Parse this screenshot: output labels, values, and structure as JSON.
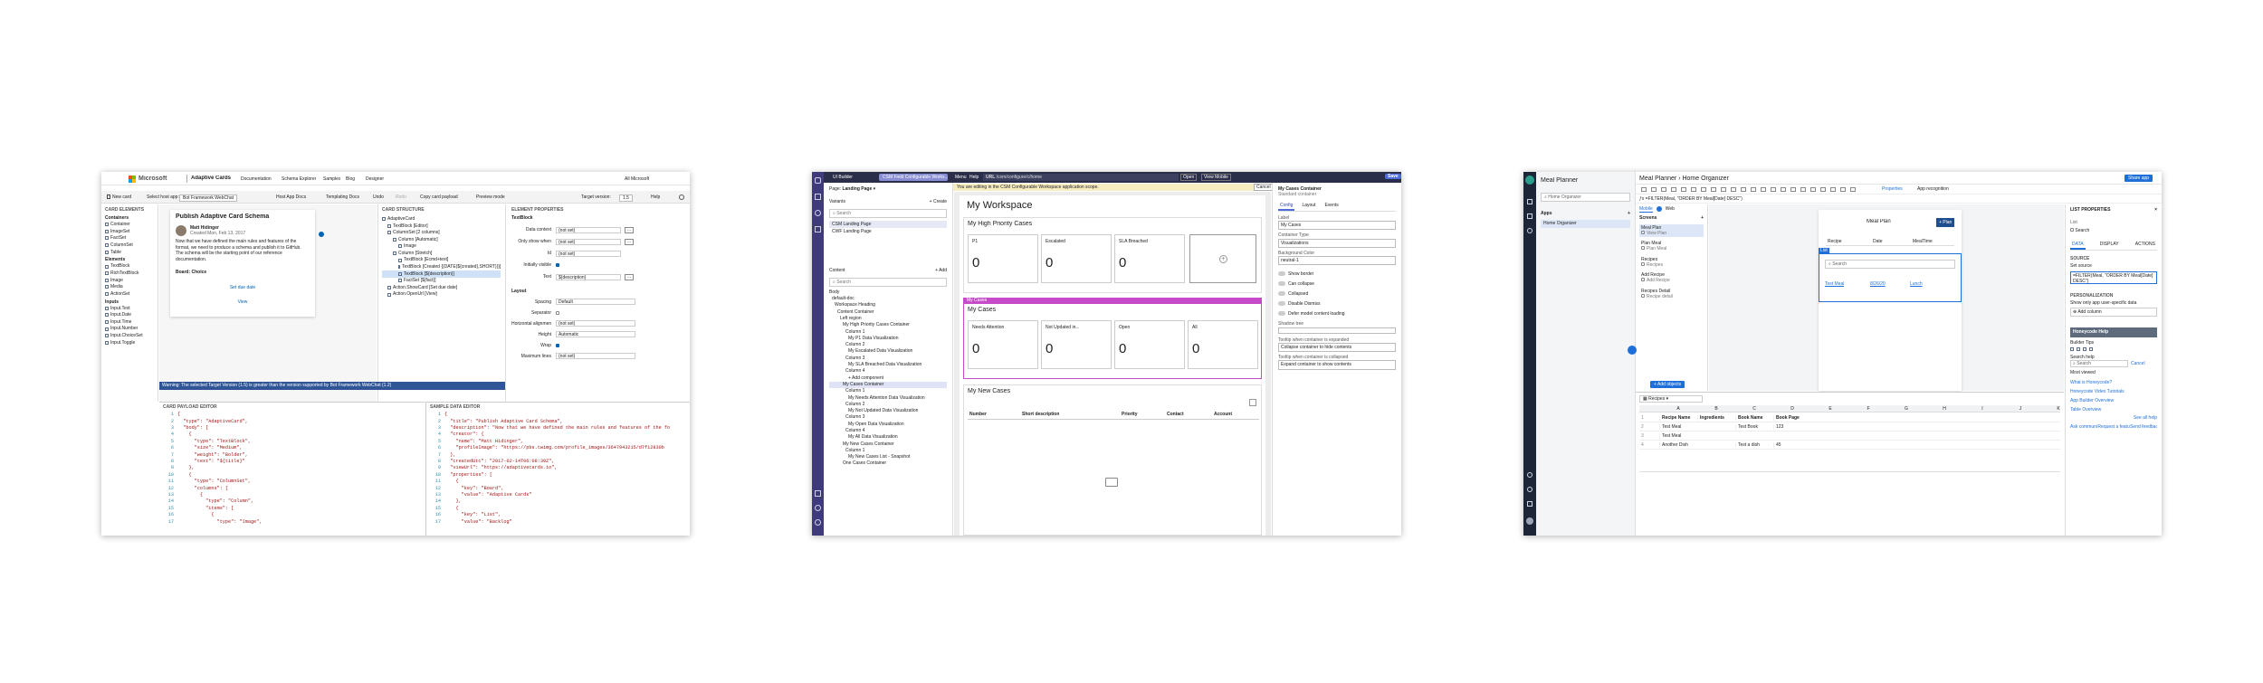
{
  "ac": {
    "brand": "Microsoft",
    "title": "Adaptive Cards",
    "nav": [
      "Documentation",
      "Schema Explorer",
      "Samples",
      "Blog",
      "Designer"
    ],
    "account": "All Microsoft",
    "toolbar": [
      "New card",
      "Select host app:",
      "Bot Framework WebChat",
      "Host App Docs",
      "Templating Docs",
      "Undo",
      "Redo",
      "Copy card payload",
      "Preview mode"
    ],
    "target_label": "Target version:",
    "target_value": "1.5",
    "help": "Help",
    "elements_title": "CARD ELEMENTS",
    "elements_groups": [
      {
        "name": "Containers",
        "items": [
          "Container",
          "ImageSet",
          "FactSet",
          "ColumnSet",
          "Table"
        ]
      },
      {
        "name": "Elements",
        "items": [
          "TextBlock",
          "RichTextBlock",
          "Image",
          "Media",
          "ActionSet"
        ]
      },
      {
        "name": "Inputs",
        "items": [
          "Input.Text",
          "Input.Date",
          "Input.Time",
          "Input.Number",
          "Input.ChoiceSet",
          "Input.Toggle"
        ]
      }
    ],
    "card": {
      "title": "Publish Adaptive Card Schema",
      "author": "Matt Hidinger",
      "created": "Created Mon, Feb 13, 2017",
      "body": "Now that we have defined the main rules and features of the format, we need to produce a schema and publish it to GitHub. The schema will be the starting point of our reference documentation.",
      "choice": "Choice",
      "due": "Set due date",
      "view": "View"
    },
    "structure_title": "CARD STRUCTURE",
    "structure": [
      "AdaptiveCard",
      "TextBlock [Editor]",
      "ColumnSet [2 columns]",
      "Column [Automatic]",
      "Image",
      "Column [Stretch]",
      "TextBlock [Ecmd+text]",
      "TextBlock [Created {{DATE(${created},SHORT)}}]",
      "TextBlock [${description}]",
      "FactSet [${fact}]",
      "Action.ShowCard [Set due date]",
      "Action.OpenUrl [View]"
    ],
    "props_title": "ELEMENT PROPERTIES",
    "props_type": "TextBlock",
    "props": [
      [
        "Data context",
        "(not set)"
      ],
      [
        "Only show when",
        "(not set)"
      ],
      [
        "Id",
        "(not set)"
      ],
      [
        "Initially visible",
        ""
      ],
      [
        "Text",
        "${description}"
      ]
    ],
    "layout_title": "Layout",
    "layout": [
      [
        "Spacing",
        "Default"
      ],
      [
        "Separator",
        ""
      ],
      [
        "Horizontal alignment",
        "(not set)"
      ],
      [
        "Height",
        "Automatic"
      ],
      [
        "Wrap",
        ""
      ],
      [
        "Maximum lines",
        "(not set)"
      ]
    ],
    "warning": "Warning: The selected Target Version (1.5) is greater than the version supported by Bot Framework WebChat (1.2)",
    "payload_title": "CARD PAYLOAD EDITOR",
    "payload_lines": [
      "{",
      "  \"type\": \"AdaptiveCard\",",
      "  \"body\": [",
      "    {",
      "      \"type\": \"TextBlock\",",
      "      \"size\": \"Medium\",",
      "      \"weight\": \"Bolder\",",
      "      \"text\": \"${title}\"",
      "    },",
      "    {",
      "      \"type\": \"ColumnSet\",",
      "      \"columns\": [",
      "        {",
      "          \"type\": \"Column\",",
      "          \"items\": [",
      "            {",
      "              \"type\": \"Image\","
    ],
    "sample_title": "SAMPLE DATA EDITOR",
    "sample_lines": [
      "{",
      "  \"title\": \"Publish Adaptive Card Schema\",",
      "  \"description\": \"Now that we have defined the main rules and features of the fo",
      "  \"creator\": {",
      "    \"name\": \"Matt Hidinger\",",
      "    \"profileImage\": \"https://pbs.twimg.com/profile_images/3647943215/d7f12830b",
      "  },",
      "  \"createdUtc\": \"2017-02-14T06:08:39Z\",",
      "  \"viewUrl\": \"https://adaptivecards.io\",",
      "  \"properties\": [",
      "    {",
      "      \"key\": \"Board\",",
      "      \"value\": \"Adaptive Cards\"",
      "    },",
      "    {",
      "      \"key\": \"List\",",
      "      \"value\": \"Backlog\""
    ]
  },
  "ui": {
    "title": "UI Builder",
    "tab": "CSM Field Configurable Works...",
    "menu": [
      "Menu",
      "Help"
    ],
    "url": "/csm/configure/c/home",
    "open": "Open",
    "view_mode": "View Mobile",
    "save": "Save",
    "banner": "You are editing in the CSM Configurable Workspace application scope.",
    "cancel": "Cancel",
    "page_label": "Page",
    "page_value": "Landing Page",
    "variants_title": "Variants",
    "create": "+ Create",
    "search": "Search",
    "variants": [
      "CSM Landing Page",
      "CWF Landing Page"
    ],
    "content_title": "Content",
    "add": "+ Add",
    "tree": [
      "Body",
      "default-doc",
      "Workspace Heading",
      "Content Container",
      "Left region",
      "My High Priority Cases Container",
      "Column 1",
      "My P1 Data Visualization",
      "Column 2",
      "My Escalated Data Visualization",
      "Column 3",
      "My SLA Breached Data Visualization",
      "Column 4",
      "+ Add component",
      "My Cases Container",
      "Column 1",
      "My Needs Attention Data Visualization",
      "Column 2",
      "My Not Updated Data Visualization",
      "Column 3",
      "My Open Data Visualization",
      "Column 4",
      "My All Data Visualization",
      "My New Cases Container",
      "Column 1",
      "My New Cases List - Snapshot",
      "One Cases Container"
    ],
    "ws_title": "My Workspace",
    "hp_title": "My High Priority Cases",
    "hp_cards": [
      {
        "label": "P1",
        "value": "0"
      },
      {
        "label": "Escalated",
        "value": "0"
      },
      {
        "label": "SLA Breached",
        "value": "0"
      }
    ],
    "toolbar_tag": "My Cases",
    "mc_title": "My Cases",
    "mc_cards": [
      {
        "label": "Needs Attention",
        "value": "0"
      },
      {
        "label": "Not Updated in...",
        "value": "0"
      },
      {
        "label": "Open",
        "value": "0"
      },
      {
        "label": "All",
        "value": "0"
      }
    ],
    "nc_title": "My New Cases",
    "nc_cols": [
      "Number",
      "Short description",
      "Priority",
      "Contact",
      "Account"
    ],
    "cfg_title": "My Cases Container",
    "cfg_sub": "Standard container",
    "cfg_tabs": [
      "Config",
      "Layout",
      "Events"
    ],
    "cfg_fields": [
      [
        "Label",
        "My Cases"
      ],
      [
        "Container Type",
        "Visualizations"
      ],
      [
        "Background Color",
        "neutral-1"
      ]
    ],
    "cfg_toggles": [
      "Show border",
      "Can collapse",
      "Collapsed",
      "Disable Dismiss",
      "Defer model content loading"
    ],
    "cfg_text": [
      [
        "Tooltip when container is expanded",
        "Collapse container to hide contents"
      ],
      [
        "Tooltip when container is collapsed",
        "Expand container to show contents"
      ]
    ],
    "shadow_label": "Shadow tree"
  },
  "pa": {
    "app": "Meal Planner",
    "crumb": "Home Organizer",
    "share": "Share app",
    "apps_title": "Apps",
    "search": "Home Organizer",
    "apps": [
      "Home Organizer"
    ],
    "tabs": [
      "Mobile",
      "Web"
    ],
    "screens_title": "Screens",
    "screens": [
      [
        "Meal Plan",
        "View Plan"
      ],
      [
        "Plan Meal",
        "Plan Meal"
      ],
      [
        "Recipes",
        "Recipes"
      ],
      [
        "Add Recipe",
        "Add Recipe"
      ],
      [
        "Recipes Detail",
        "Recipe detail"
      ]
    ],
    "add_objects": "Add objects",
    "formula": "=FILTER(Meal, \"ORDER BY Meal[Date] DESC\")",
    "props_toggle": "Properties",
    "app_recognition": "App recognition",
    "share_btn": "Share app",
    "preview_title": "Meal Plan",
    "plan_btn": "+ Plan",
    "cols": [
      "Recipe",
      "Date",
      "MealTime"
    ],
    "list_search": "Search",
    "row": [
      "Test Meal",
      "8/26/20",
      "Lunch"
    ],
    "grid_sheet": "Recipes",
    "grid_headers": [
      "A",
      "B",
      "C",
      "D",
      "E",
      "F",
      "G",
      "H",
      "I",
      "J",
      "K"
    ],
    "grid_rows": [
      [
        "Recipe Name",
        "Ingredients",
        "Book Name",
        "Book Page"
      ],
      [
        "Test Meal",
        "",
        "Test Book",
        "123"
      ],
      [
        "Test Meal",
        "",
        "",
        ""
      ],
      [
        "Another Dish",
        "",
        "Test a dish",
        "45"
      ]
    ],
    "rp_title": "LIST PROPERTIES",
    "rp_list": "List",
    "rp_item": "Search",
    "rp_tabs": [
      "DATA",
      "DISPLAY",
      "ACTIONS"
    ],
    "rp_source_title": "SOURCE",
    "rp_source_label": "Set source",
    "rp_source_value": "=FILTER(Meal, \"ORDER BY Meal[Date] DESC\")",
    "rp_personal": "PERSONALIZATION",
    "rp_personal_label": "Show only app user-specific data",
    "rp_add": "Add column",
    "rp_help_title": "Honeycode Help",
    "rp_builder": "Builder Tips",
    "rp_search_help": "Search help",
    "rp_search": "Search",
    "rp_cancel": "Cancel",
    "rp_newest": "Most viewed",
    "rp_links": [
      "What is Honeycode?",
      "Honeycode Video Tutorials",
      "App Builder Overview",
      "Table Overview"
    ],
    "rp_see_all": "See all help",
    "rp_footer": [
      "Ask community",
      "Request a feature",
      "Send feedback"
    ]
  }
}
